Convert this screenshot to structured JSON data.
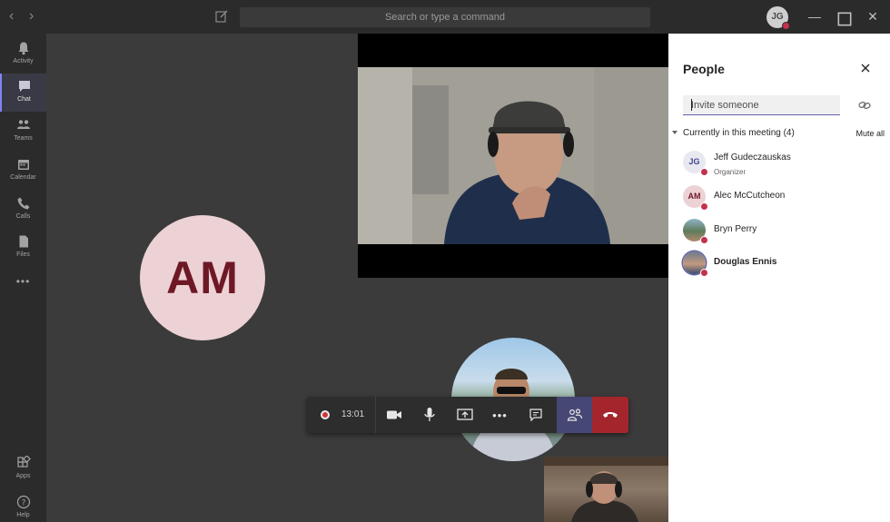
{
  "titlebar": {
    "search_placeholder": "Search or type a command",
    "user_initials": "JG"
  },
  "rail": {
    "items": [
      {
        "label": "Activity",
        "icon": "bell-icon"
      },
      {
        "label": "Chat",
        "icon": "chat-icon"
      },
      {
        "label": "Teams",
        "icon": "teams-icon"
      },
      {
        "label": "Calendar",
        "icon": "calendar-icon"
      },
      {
        "label": "Calls",
        "icon": "phone-icon"
      },
      {
        "label": "Files",
        "icon": "file-icon"
      }
    ],
    "more": "•••",
    "bottom": [
      {
        "label": "Apps",
        "icon": "apps-icon"
      },
      {
        "label": "Help",
        "icon": "help-icon"
      }
    ]
  },
  "stage": {
    "participant_initials": "AM"
  },
  "controls": {
    "timer": "13:01"
  },
  "panel": {
    "title": "People",
    "invite_placeholder": "Invite someone",
    "section_label": "Currently in this meeting (4)",
    "mute_all": "Mute all",
    "people": [
      {
        "name": "Jeff Gudeczauskas",
        "role": "Organizer",
        "initials": "JG"
      },
      {
        "name": "Alec McCutcheon",
        "role": "",
        "initials": "AM"
      },
      {
        "name": "Bryn Perry",
        "role": "",
        "initials": ""
      },
      {
        "name": "Douglas Ennis",
        "role": "",
        "initials": ""
      }
    ]
  },
  "colors": {
    "accent": "#6264a7",
    "hangup": "#a4262c",
    "status_busy": "#c4314b",
    "am_avatar_bg": "#ecd2d5",
    "am_avatar_text": "#6e1826"
  }
}
